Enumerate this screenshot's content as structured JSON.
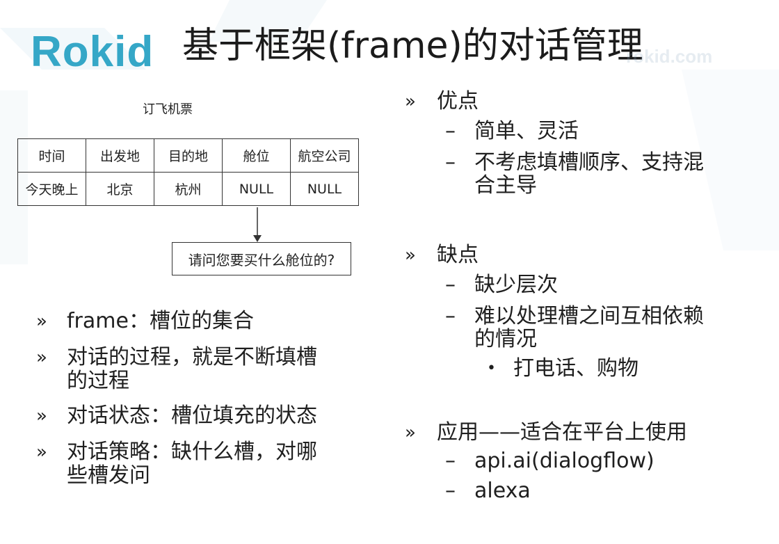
{
  "header": {
    "logo": "Rokid",
    "title": "基于框架(frame)的对话管理",
    "watermark": "rokid.com"
  },
  "diagram": {
    "caption": "订飞机票",
    "headers": [
      "时间",
      "出发地",
      "目的地",
      "舱位",
      "航空公司"
    ],
    "values": [
      "今天晚上",
      "北京",
      "杭州",
      "NULL",
      "NULL"
    ],
    "question": "请问您要买什么舱位的?"
  },
  "left_bullets": [
    {
      "marker": "»",
      "text": "frame：槽位的集合"
    },
    {
      "marker": "»",
      "line1": "对话的过程，就是不断填槽",
      "line2": "的过程"
    },
    {
      "marker": "»",
      "text": "对话状态：槽位填充的状态"
    },
    {
      "marker": "»",
      "line1": "对话策略：缺什么槽，对哪",
      "line2": "些槽发问"
    }
  ],
  "right": {
    "pros": {
      "marker": "»",
      "label": "优点",
      "items": [
        {
          "dash": "–",
          "text": "简单、灵活"
        },
        {
          "dash": "–",
          "line1": "不考虑填槽顺序、支持混",
          "line2": "合主导"
        }
      ]
    },
    "cons": {
      "marker": "»",
      "label": "缺点",
      "items": [
        {
          "dash": "–",
          "text": "缺少层次"
        },
        {
          "dash": "–",
          "line1": "难以处理槽之间互相依赖",
          "line2": "的情况"
        }
      ],
      "sub": {
        "dot": "•",
        "text": "打电话、购物"
      }
    },
    "apps": {
      "marker": "»",
      "label": "应用——适合在平台上使用",
      "items": [
        {
          "dash": "–",
          "text": "api.ai(dialogflow)"
        },
        {
          "dash": "–",
          "text": "alexa"
        }
      ]
    }
  }
}
